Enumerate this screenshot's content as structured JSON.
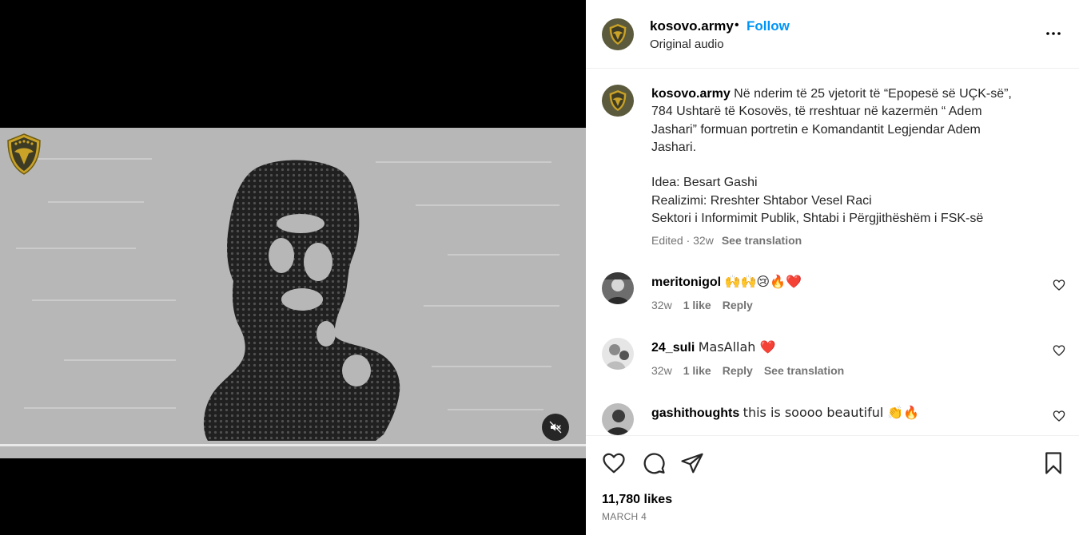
{
  "header": {
    "username": "kosovo.army",
    "separator": "•",
    "follow_label": "Follow",
    "audio_label": "Original audio"
  },
  "caption": {
    "username": "kosovo.army",
    "lines": [
      "Në nderim të 25 vjetorit të “Epopesë së UÇK-së”,",
      "784 Ushtarë të Kosovës, të rreshtuar në kazermën “ Adem",
      "Jashari” formuan portretin e Komandantit Legjendar Adem",
      "Jashari.",
      "",
      "Idea: Besart Gashi",
      "Realizimi: Rreshter Shtabor Vesel Raci",
      "Sektori i Informimit Publik, Shtabi i Përgjithëshëm i FSK-së"
    ],
    "meta": "Edited · 32w",
    "see_translation": "See translation"
  },
  "comments": [
    {
      "username": "meritonigol",
      "text": "🙌🙌😢🔥❤️",
      "age": "32w",
      "likes": "1 like",
      "reply": "Reply",
      "see_translation": ""
    },
    {
      "username": "24_suli",
      "text": "MasAllah ❤️",
      "age": "32w",
      "likes": "1 like",
      "reply": "Reply",
      "see_translation": "See translation"
    },
    {
      "username": "gashithoughts",
      "text": "this is soooo beautiful 👏🔥",
      "age": "",
      "likes": "",
      "reply": "",
      "see_translation": ""
    }
  ],
  "stats": {
    "likes": "11,780 likes",
    "date": "MARCH 4"
  },
  "icons": {
    "more": "more-horizontal-icon",
    "mute": "speaker-muted-icon",
    "like": "heart-icon",
    "comment": "comment-bubble-icon",
    "share": "paper-plane-icon",
    "save": "bookmark-icon"
  },
  "colors": {
    "accent": "#0095f6",
    "army_olive": "#5b5a3c",
    "army_gold": "#c9a227",
    "video_ground": "#b9b9b9"
  }
}
